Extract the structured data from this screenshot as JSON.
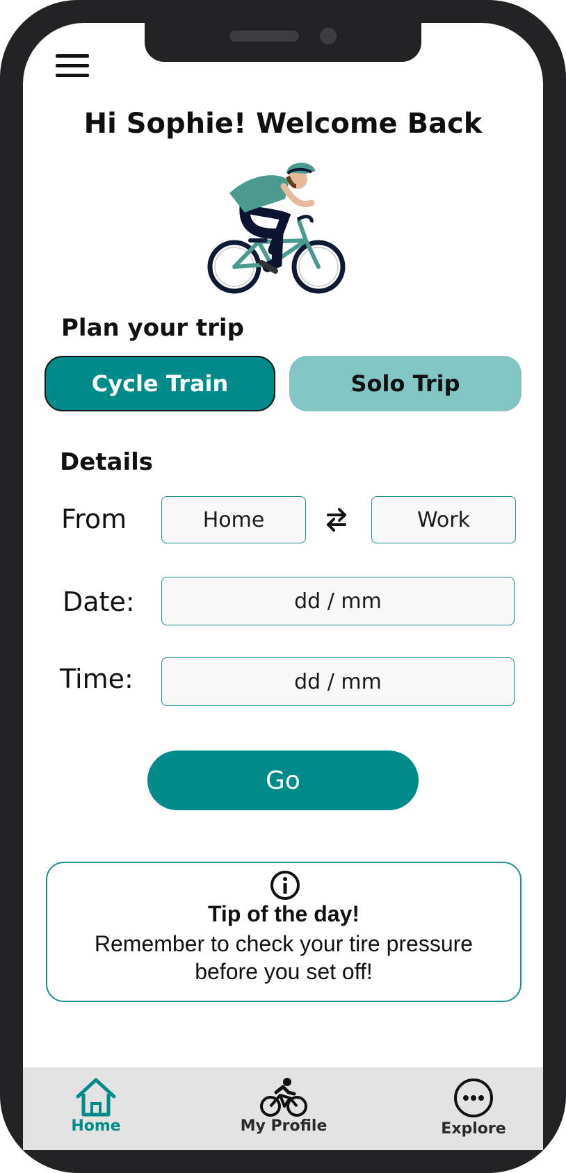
{
  "greeting": "Hi Sophie! Welcome Back",
  "plan": {
    "title": "Plan your trip",
    "options": [
      "Cycle Train",
      "Solo Trip"
    ],
    "selected": "Cycle Train"
  },
  "details": {
    "title": "Details",
    "from_label": "From",
    "from_value": "Home",
    "to_value": "Work",
    "date_label": "Date:",
    "date_placeholder": "dd / mm",
    "time_label": "Time:",
    "time_placeholder": "dd / mm"
  },
  "go_label": "Go",
  "tip": {
    "title": "Tip of the day!",
    "body": "Remember to check your tire pressure before you set off!"
  },
  "nav": [
    {
      "label": "Home",
      "icon": "home-icon",
      "active": true
    },
    {
      "label": "My Profile",
      "icon": "cyclist-icon",
      "active": false
    },
    {
      "label": "Explore",
      "icon": "more-icon",
      "active": false
    }
  ],
  "colors": {
    "accent": "#008b8b",
    "accent_light": "#82c5c5",
    "tabbar_bg": "#e3e3e3"
  }
}
